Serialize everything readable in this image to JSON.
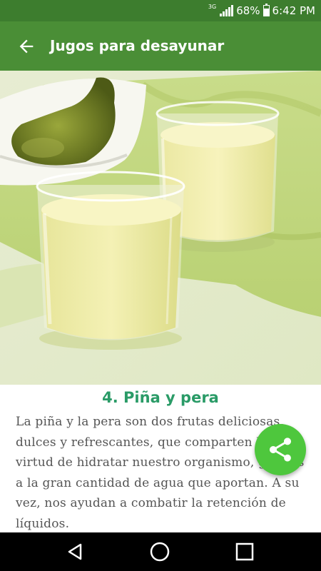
{
  "status_bar": {
    "network": "3G",
    "battery": "68%",
    "battery_level": 0.68,
    "time": "6:42 PM"
  },
  "app_bar": {
    "title": "Jugos para desayunar",
    "back_icon": "arrow-left-icon"
  },
  "hero_image": {
    "subject": "two glasses of pineapple and pear juice with a pear in a bowl"
  },
  "article": {
    "title": "4. Piña y pera",
    "body": "La piña y la pera son dos frutas deliciosas, dulces y refrescantes, que comparten la virtud de hidratar nuestro organismo, gracias a la gran cantidad de agua que aportan. A su vez, nos ayudan a combatir la retención de líquidos."
  },
  "fab": {
    "icon": "share-icon"
  },
  "nav_bar": {
    "icons": [
      "back-triangle-icon",
      "home-circle-icon",
      "recents-square-icon"
    ]
  },
  "colors": {
    "status_bar": "#3d7d2e",
    "app_bar": "#4a8e36",
    "title_text": "#2a9b67",
    "fab": "#4ec73d"
  }
}
